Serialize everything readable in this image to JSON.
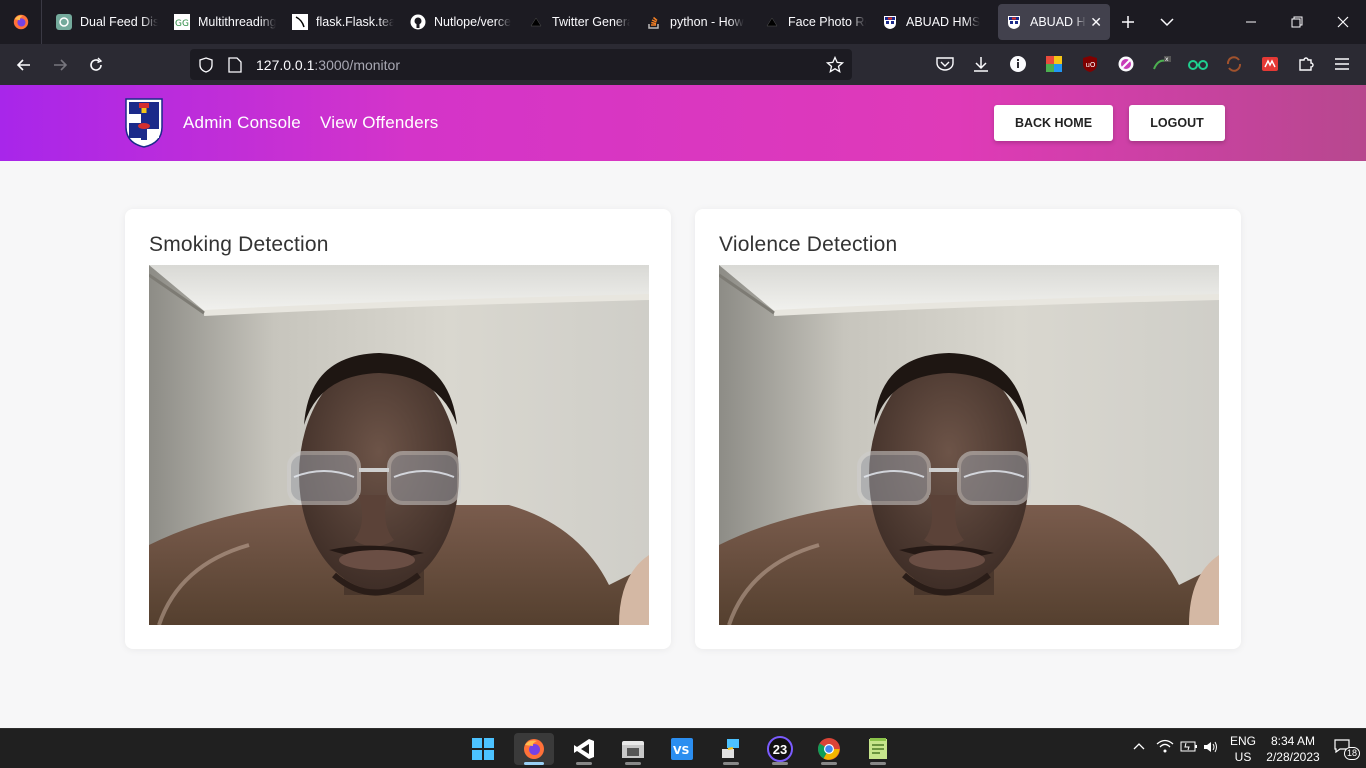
{
  "browser": {
    "tabs": [
      {
        "label": "Dual Feed Disp",
        "icon": "chatgpt-icon"
      },
      {
        "label": "Multithreading",
        "icon": "geeks-icon"
      },
      {
        "label": "flask.Flask.tea",
        "icon": "flask-icon"
      },
      {
        "label": "Nutlope/verce",
        "icon": "github-icon"
      },
      {
        "label": "Twitter Genera",
        "icon": "vercel-icon"
      },
      {
        "label": "python - How",
        "icon": "stackoverflow-icon"
      },
      {
        "label": "Face Photo Re",
        "icon": "vercel-icon"
      },
      {
        "label": "ABUAD HMS",
        "icon": "abuad-icon"
      },
      {
        "label": "ABUAD HMS",
        "icon": "abuad-icon",
        "active": true
      }
    ],
    "url": {
      "host": "127.0.0.1",
      "path": ":3000/monitor"
    }
  },
  "header": {
    "nav_admin": "Admin Console",
    "nav_offenders": "View Offenders",
    "back_home": "BACK HOME",
    "logout": "LOGOUT",
    "gradient_start": "#a826ea",
    "gradient_end": "#b7488e"
  },
  "cards": [
    {
      "title": "Smoking Detection"
    },
    {
      "title": "Violence Detection"
    }
  ],
  "taskbar": {
    "lang": "ENG",
    "region": "US",
    "time": "8:34 AM",
    "date": "2/28/2023",
    "notifications": "18",
    "calendar_badge": "23"
  }
}
